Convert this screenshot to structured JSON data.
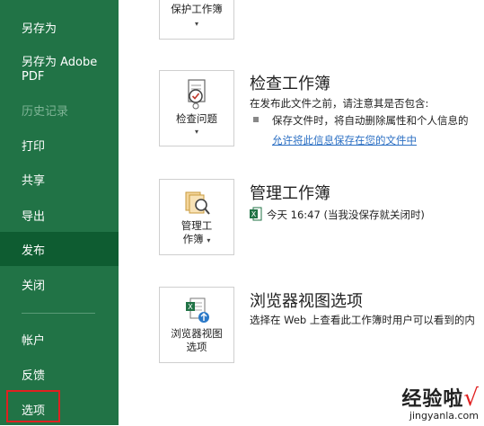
{
  "sidebar": {
    "items": [
      {
        "label": "另存为"
      },
      {
        "label": "另存为 Adobe PDF"
      },
      {
        "label": "历史记录"
      },
      {
        "label": "打印"
      },
      {
        "label": "共享"
      },
      {
        "label": "导出"
      },
      {
        "label": "发布"
      },
      {
        "label": "关闭"
      },
      {
        "label": "帐户"
      },
      {
        "label": "反馈"
      },
      {
        "label": "选项"
      }
    ]
  },
  "protect": {
    "button_label": "保护工作簿"
  },
  "inspect": {
    "button_label": "检查问题",
    "title": "检查工作簿",
    "desc": "在发布此文件之前，请注意其是否包含:",
    "bullet": "保存文件时，将自动删除属性和个人信息的",
    "link": "允许将此信息保存在您的文件中"
  },
  "manage": {
    "button_line1": "管理工",
    "button_line2": "作簿",
    "title": "管理工作簿",
    "version": "今天 16:47 (当我没保存就关闭时)"
  },
  "browser": {
    "button_line1": "浏览器视图",
    "button_line2": "选项",
    "title": "浏览器视图选项",
    "desc": "选择在 Web 上查看此工作簿时用户可以看到的内"
  },
  "watermark": {
    "text": "经验啦",
    "check": "√",
    "url": "jingyanla.com"
  },
  "colors": {
    "sidebar": "#217346",
    "active": "#0e5c31",
    "highlight": "#e02020",
    "link": "#2b6fc3"
  }
}
